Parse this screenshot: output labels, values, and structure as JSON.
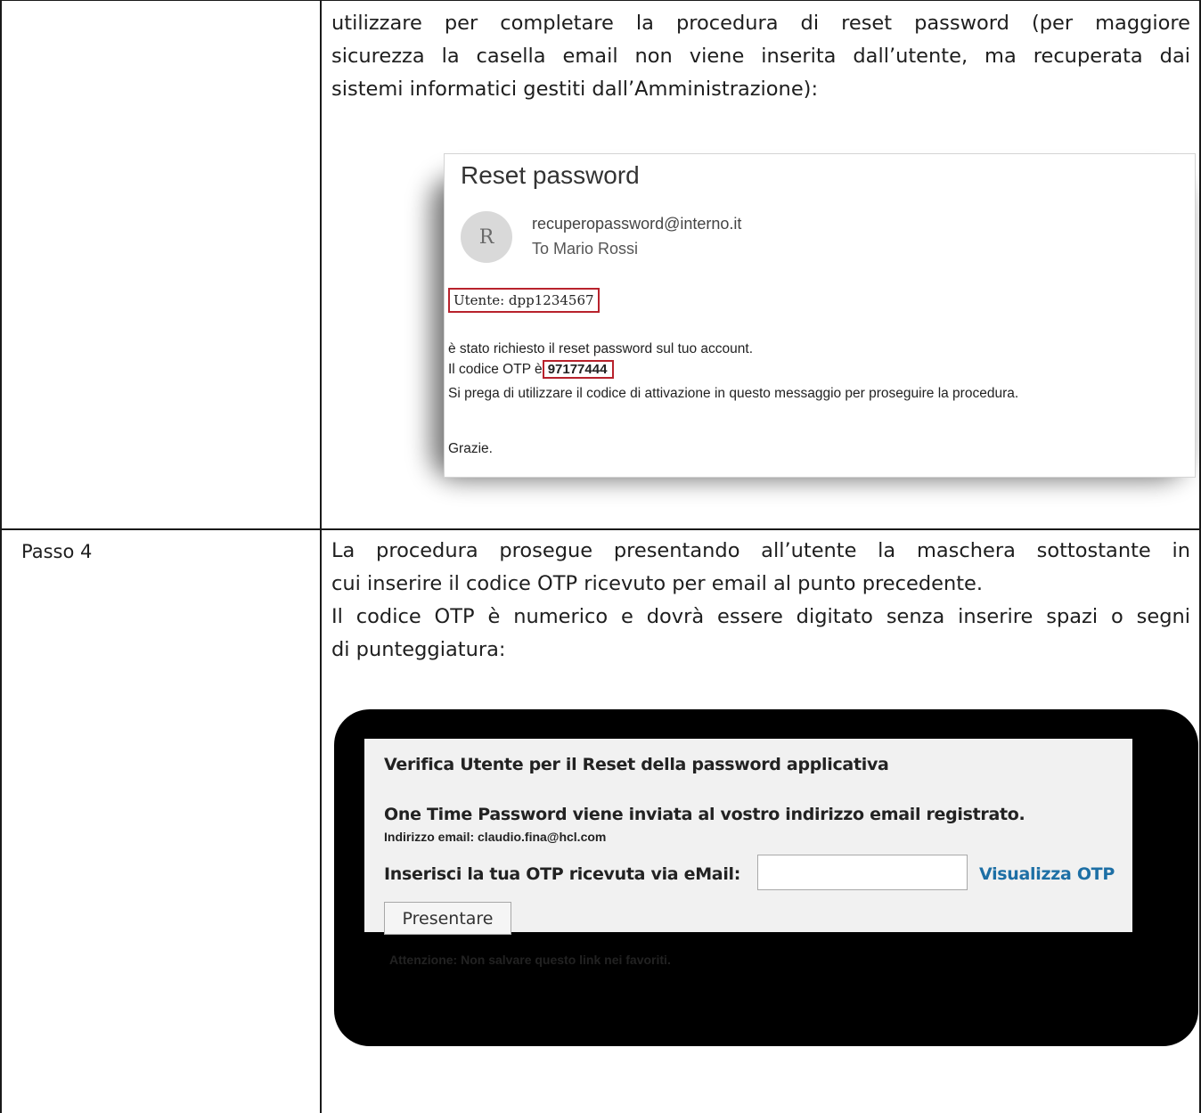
{
  "document": {
    "top_paragraph": [
      "utilizzare per completare la procedura di reset password (per maggiore",
      "sicurezza la casella email non viene inserita dall’utente, ma recuperata dai",
      "sistemi informatici gestiti dall’Amministrazione):"
    ],
    "step_label": "Passo 4",
    "step_paragraph": [
      "La procedura prosegue presentando all’utente la maschera sottostante in",
      "cui inserire il codice OTP ricevuto per email al punto precedente.",
      "Il codice OTP è numerico e dovrà essere digitato senza inserire spazi o segni",
      "di punteggiatura:"
    ]
  },
  "email": {
    "title": "Reset password",
    "avatar_initial": "R",
    "sender": "recuperopassword@interno.it",
    "recipient": "To  Mario Rossi",
    "user": "Utente: dpp1234567",
    "line1": "è stato richiesto il reset password sul tuo account.",
    "otp_prefix": "Il codice OTP è",
    "otp_code": "97177444",
    "line3": "Si prega di utilizzare il codice di attivazione in questo messaggio per proseguire la procedura.",
    "thanks": "Grazie.",
    "highlight_color": "#b8222c"
  },
  "otp_form": {
    "heading": "Verifica Utente per il Reset della password applicativa",
    "subheading": "One Time Password viene inviata al vostro indirizzo email registrato.",
    "email_line": "Indirizzo email: claudio.fina@hcl.com",
    "input_label": "Inserisci la tua OTP ricevuta via eMail:",
    "input_value": "",
    "show_link": "Visualizza OTP",
    "submit_label": "Presentare",
    "warning": "Attenzione: Non salvare questo link nei favoriti.",
    "link_color": "#1d6fa5"
  }
}
